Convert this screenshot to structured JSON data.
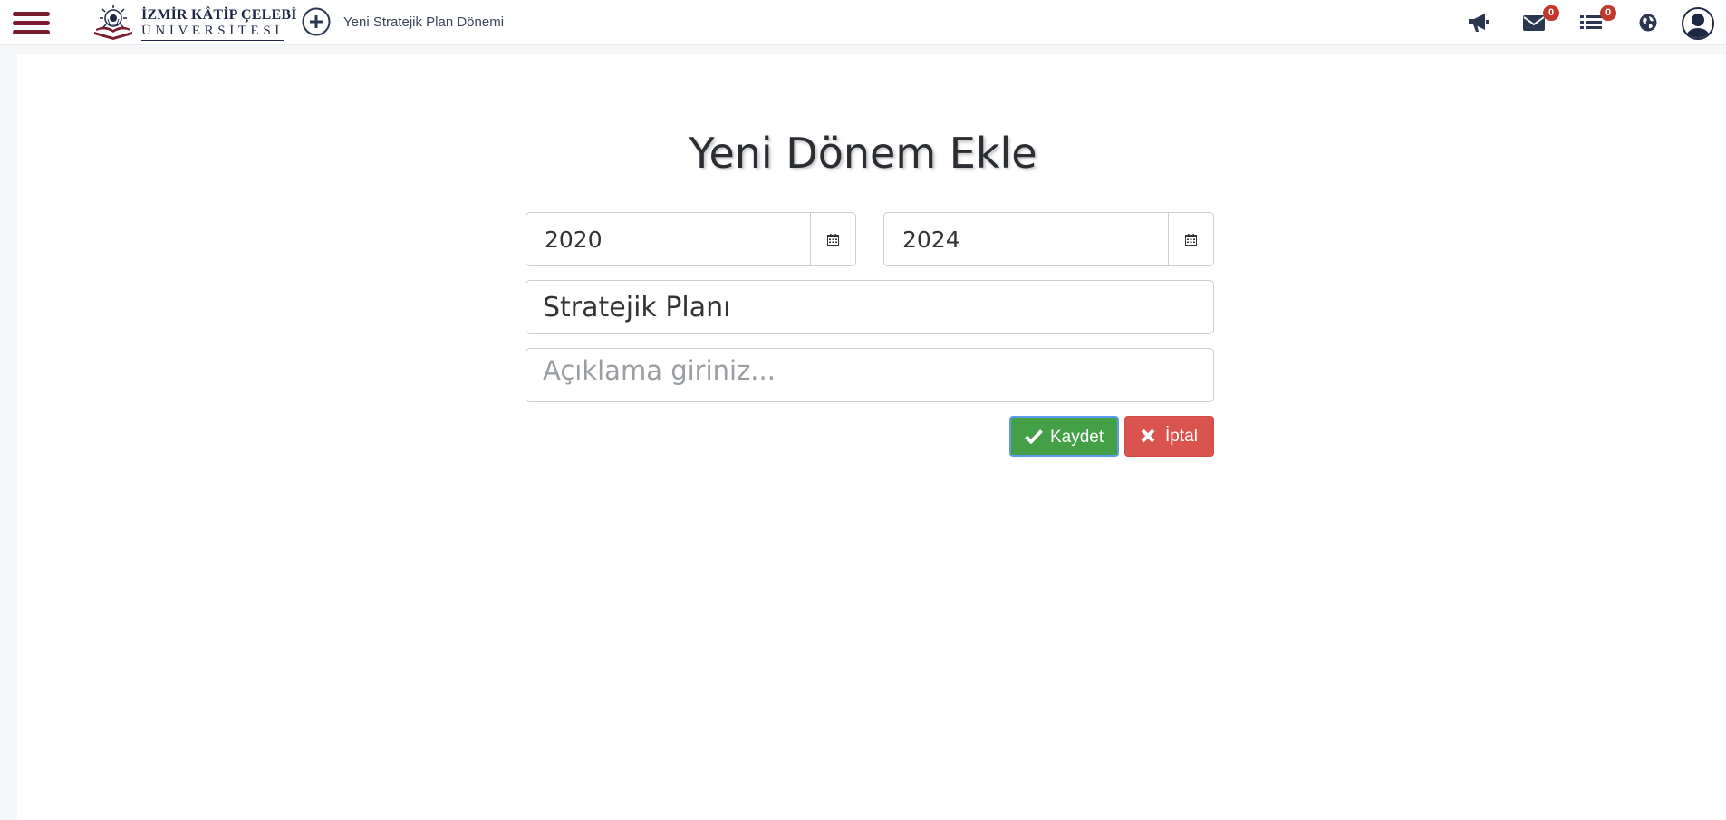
{
  "header": {
    "logo_line1": "İZMİR KÂTİP ÇELEBİ",
    "logo_line2": "ÜNİVERSİTESİ",
    "page_title": "Yeni Stratejik Plan Dönemi",
    "messages_count": "0",
    "tasks_count": "0"
  },
  "form": {
    "title": "Yeni Dönem Ekle",
    "start_year": "2020",
    "end_year": "2024",
    "name_value": "Stratejik Planı",
    "description_placeholder": "Açıklama giriniz...",
    "save_label": "Kaydet",
    "cancel_label": "İptal"
  },
  "colors": {
    "brand": "#7a1a2d",
    "navy": "#1e2744",
    "save": "#43a047",
    "cancel": "#d9534f",
    "badge": "#c0392b"
  },
  "icons": {
    "menu": "hamburger-icon",
    "add": "plus-circle-icon",
    "announce": "megaphone-icon",
    "mail": "envelope-icon",
    "tasks": "list-icon",
    "language": "globe-icon",
    "user": "user-avatar-icon",
    "calendar": "calendar-icon",
    "check": "check-icon",
    "times": "times-icon"
  }
}
